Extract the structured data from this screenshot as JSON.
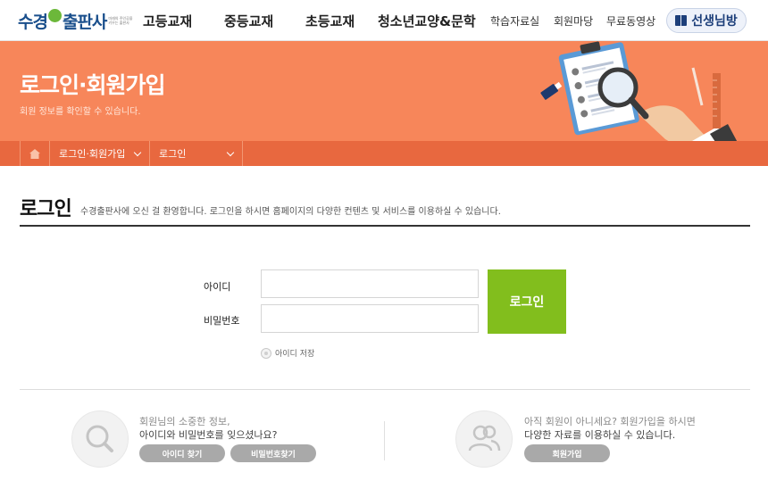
{
  "header": {
    "logo_text_1": "수경",
    "logo_text_2": "출판사",
    "logo_tagline": "미래의 주인공을 키우는 출판사",
    "nav_main": [
      "고등교재",
      "중등교재",
      "초등교재",
      "청소년교양&문학"
    ],
    "nav_sub": [
      "학습자료실",
      "회원마당",
      "무료동영상"
    ],
    "teacher_button": "선생님방"
  },
  "banner": {
    "title": "로그인·회원가입",
    "description": "회원 정보를 확인할 수 있습니다.",
    "background_color": "#f7865a"
  },
  "breadcrumb": {
    "home_icon": "home-icon",
    "level1": "로그인·회원가입",
    "level2": "로그인",
    "bar_color": "#e8683f"
  },
  "page": {
    "title": "로그인",
    "description": "수경출판사에 오신 걸 환영합니다. 로그인을 하시면 홈페이지의 다양한 컨텐츠 및 서비스를 이용하실 수 있습니다."
  },
  "login_form": {
    "id_label": "아이디",
    "id_value": "",
    "password_label": "비밀번호",
    "password_value": "",
    "login_button": "로그인",
    "login_button_color": "#82be1d",
    "save_id_label": "아이디 저장"
  },
  "find_account": {
    "icon": "search-icon",
    "line1": "회원님의 소중한 정보,",
    "line2": "아이디와 비밀번호를 잊으셨나요?",
    "find_id_button": "아이디 찾기",
    "find_password_button": "비밀번호찾기"
  },
  "join": {
    "icon": "users-icon",
    "line1": "아직 회원이 아니세요? 회원가입을 하시면",
    "line2": "다양한 자료를 이용하실 수 있습니다.",
    "join_button": "회원가입"
  }
}
